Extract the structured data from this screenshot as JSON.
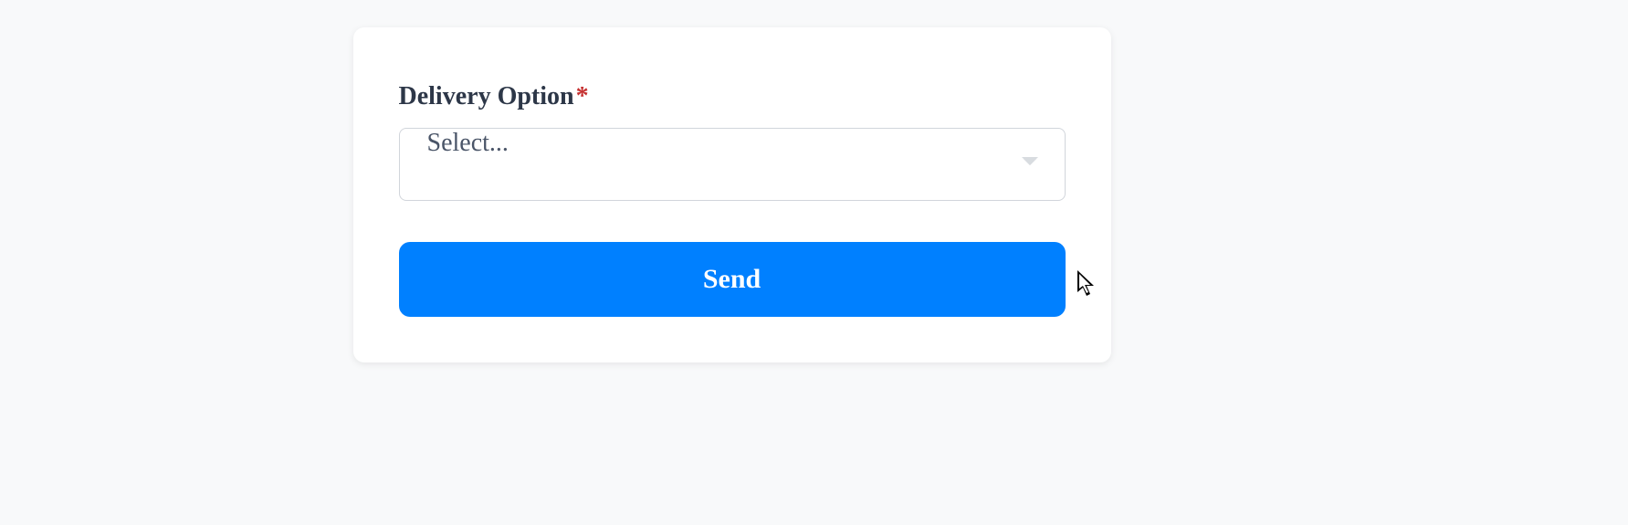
{
  "form": {
    "delivery_option_label": "Delivery Option",
    "required_marker": "*",
    "select_placeholder": "Select...",
    "send_button_label": "Send"
  }
}
